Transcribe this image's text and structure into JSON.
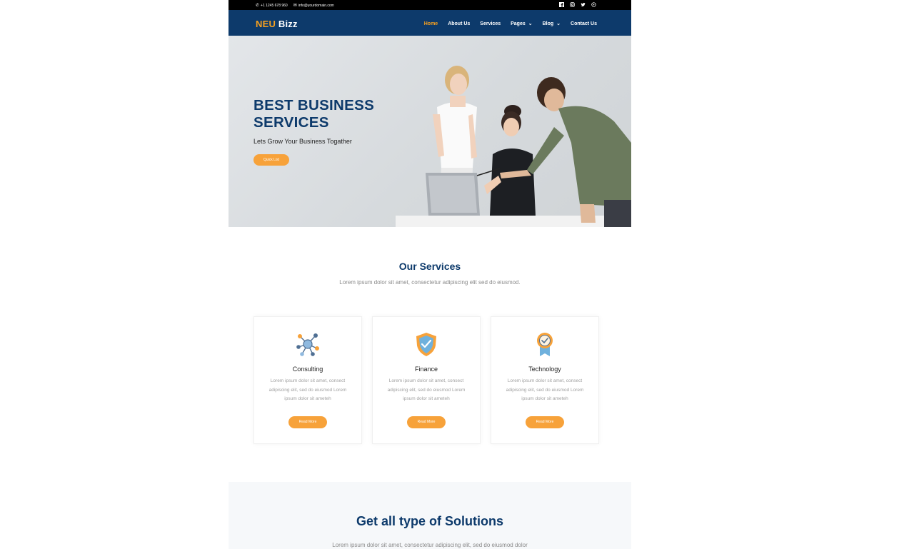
{
  "topbar": {
    "phone": "+1 1245 678 960",
    "email": "info@yourdomain.com",
    "social": [
      "facebook-icon",
      "instagram-icon",
      "twitter-icon",
      "youtube-icon"
    ]
  },
  "nav": {
    "logo_part1": "NEU",
    "logo_part2": "Bizz",
    "items": [
      {
        "label": "Home"
      },
      {
        "label": "About Us"
      },
      {
        "label": "Services"
      },
      {
        "label": "Pages"
      },
      {
        "label": "Blog"
      },
      {
        "label": "Contact Us"
      }
    ]
  },
  "hero": {
    "title": "BEST BUSINESS SERVICES",
    "subtitle": "Lets Grow Your Business Togather",
    "button": "Quick List"
  },
  "services": {
    "title": "Our Services",
    "subtitle": "Lorem ipsum dolor sit amet, consectetur adipiscing elit sed do eiusmod.",
    "cards": [
      {
        "title": "Consulting",
        "text": "Lorem ipsum dolor sit amet, consect adipiscing elit, sed do eiusmod Lorem ipsum dolor sit ameteh",
        "button": "Read More",
        "icon": "network-icon"
      },
      {
        "title": "Finance",
        "text": "Lorem ipsum dolor sit amet, consect adipiscing elit, sed do eiusmod Lorem ipsum dolor sit ameteh",
        "button": "Read More",
        "icon": "shield-check-icon"
      },
      {
        "title": "Technology",
        "text": "Lorem ipsum dolor sit amet, consect adipiscing elit, sed do eiusmod Lorem ipsum dolor sit ameteh",
        "button": "Read More",
        "icon": "award-badge-icon"
      }
    ]
  },
  "solutions": {
    "title": "Get all type of Solutions",
    "subtitle": "Lorem ipsum dolor sit amet, consectetur adipiscing elit, sed do eiusmod dolor"
  },
  "colors": {
    "brand_navy": "#0d3a6b",
    "accent_orange": "#f7a23a",
    "topbar_black": "#000000"
  }
}
